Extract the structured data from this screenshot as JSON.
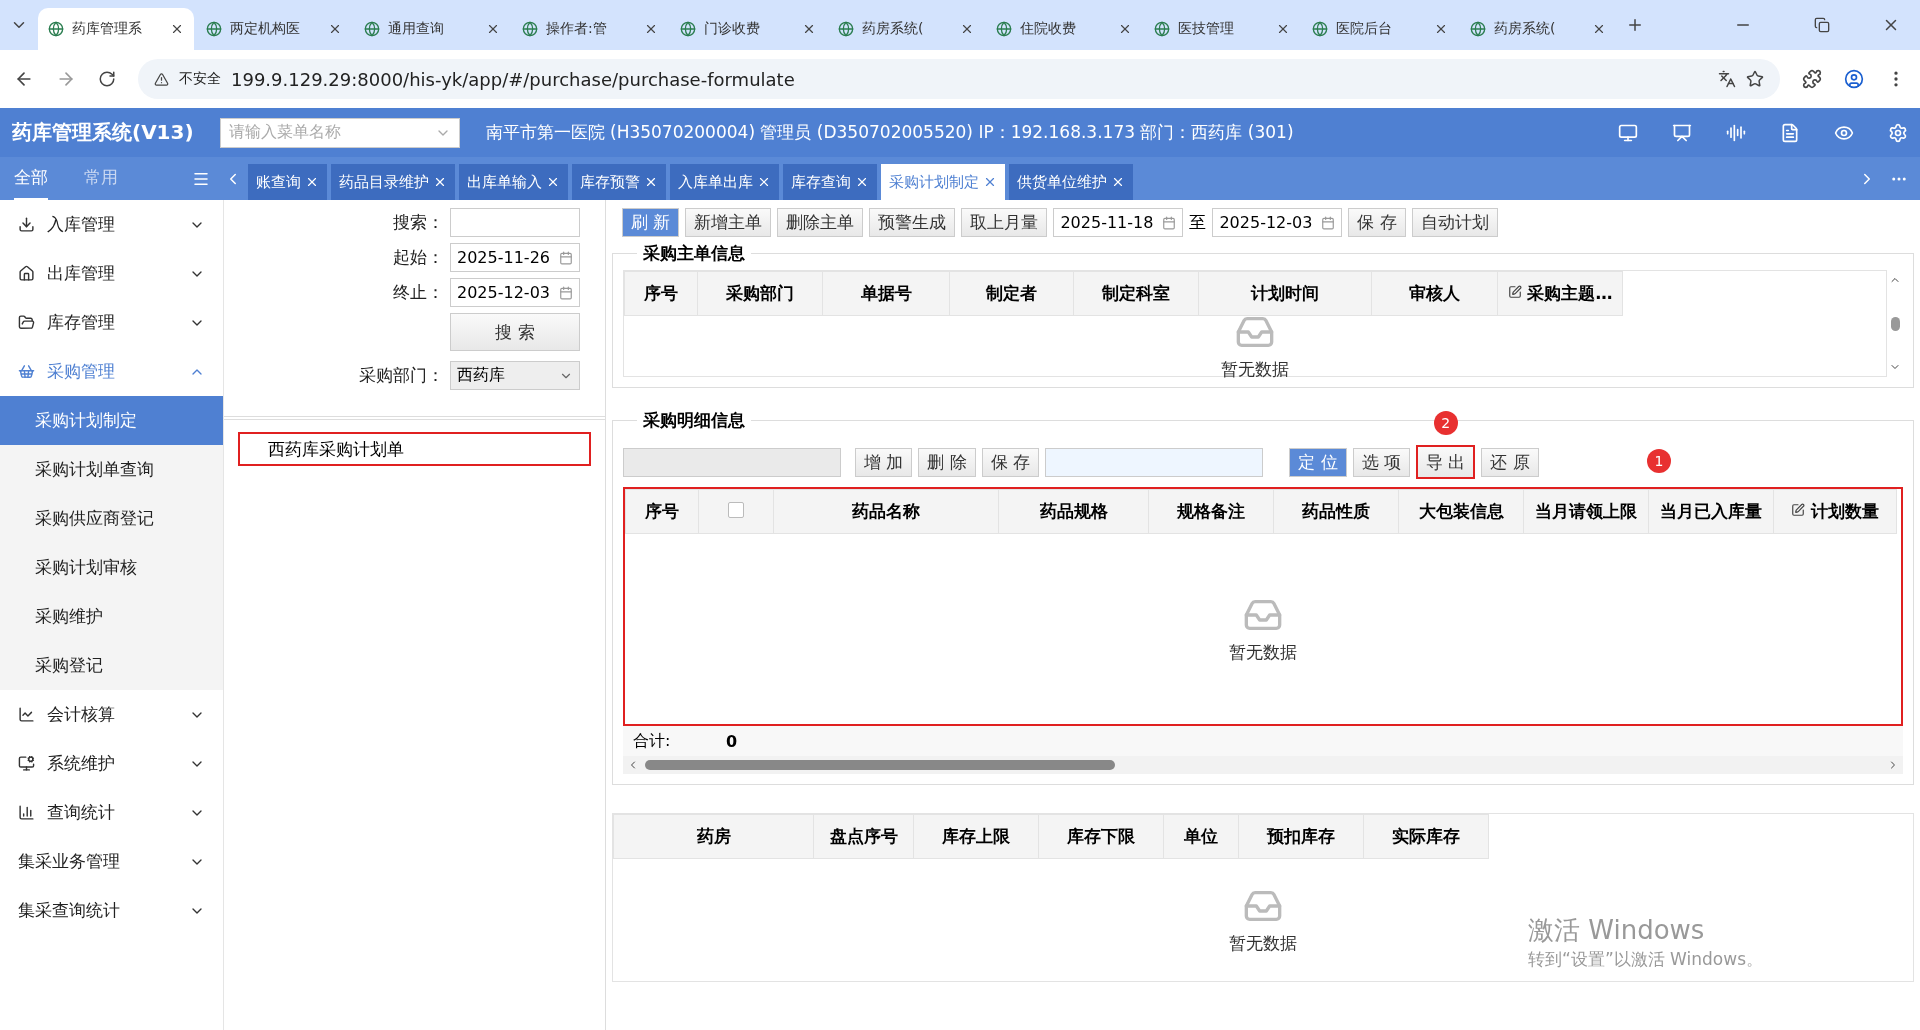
{
  "browser": {
    "tabs": [
      {
        "title": "药库管理系",
        "selected": true
      },
      {
        "title": "两定机构医",
        "selected": false
      },
      {
        "title": "通用查询",
        "selected": false
      },
      {
        "title": "操作者:管",
        "selected": false
      },
      {
        "title": "门诊收费",
        "selected": false
      },
      {
        "title": "药房系统(",
        "selected": false
      },
      {
        "title": "住院收费",
        "selected": false
      },
      {
        "title": "医技管理",
        "selected": false
      },
      {
        "title": "医院后台",
        "selected": false
      },
      {
        "title": "药房系统(",
        "selected": false
      }
    ],
    "address": {
      "warning": "不安全",
      "url": "199.9.129.29:8000/his-yk/app/#/purchase/purchase-formulate"
    }
  },
  "app": {
    "title": "药库管理系统(V13)",
    "menu_search": {
      "placeholder": "请输入菜单名称"
    },
    "info": "南平市第一医院 (H35070200004) 管理员 (D350702005520) IP：192.168.3.173 部门：西药库 (301)"
  },
  "sidebar": {
    "tabs": [
      {
        "label": "全部",
        "selected": true
      },
      {
        "label": "常用",
        "selected": false
      }
    ],
    "items": [
      {
        "label": "入库管理",
        "expanded": false
      },
      {
        "label": "出库管理",
        "expanded": false
      },
      {
        "label": "库存管理",
        "expanded": false
      },
      {
        "label": "采购管理",
        "expanded": true,
        "children": [
          {
            "label": "采购计划制定",
            "selected": true
          },
          {
            "label": "采购计划单查询",
            "selected": false
          },
          {
            "label": "采购供应商登记",
            "selected": false
          },
          {
            "label": "采购计划审核",
            "selected": false
          },
          {
            "label": "采购维护",
            "selected": false
          },
          {
            "label": "采购登记",
            "selected": false
          }
        ]
      },
      {
        "label": "会计核算",
        "expanded": false
      },
      {
        "label": "系统维护",
        "expanded": false
      },
      {
        "label": "查询统计",
        "expanded": false
      },
      {
        "label": "集采业务管理",
        "expanded": false
      },
      {
        "label": "集采查询统计",
        "expanded": false
      }
    ]
  },
  "page_tabs": [
    {
      "label": "账查询",
      "selected": false
    },
    {
      "label": "药品目录维护",
      "selected": false
    },
    {
      "label": "出库单输入",
      "selected": false
    },
    {
      "label": "库存预警",
      "selected": false
    },
    {
      "label": "入库单出库",
      "selected": false
    },
    {
      "label": "库存查询",
      "selected": false
    },
    {
      "label": "采购计划制定",
      "selected": true
    },
    {
      "label": "供货单位维护",
      "selected": false
    }
  ],
  "filter": {
    "fields": [
      {
        "label": "搜索：",
        "kind": "text"
      },
      {
        "label": "起始：",
        "kind": "date",
        "value": "2025-11-26"
      },
      {
        "label": "终止：",
        "kind": "date",
        "value": "2025-12-03"
      }
    ],
    "search_button": "搜 索",
    "department": {
      "label": "采购部门：",
      "value": "西药库"
    },
    "plans": [
      {
        "label": "西药库采购计划单",
        "highlighted": true
      }
    ]
  },
  "toolbar": [
    {
      "kind": "button",
      "label": "刷 新",
      "primary": true
    },
    {
      "kind": "button",
      "label": "新增主单",
      "primary": false
    },
    {
      "kind": "button",
      "label": "删除主单",
      "primary": false
    },
    {
      "kind": "button",
      "label": "预警生成",
      "primary": false
    },
    {
      "kind": "button",
      "label": "取上月量",
      "primary": false
    },
    {
      "kind": "date",
      "label": "2025-11-18"
    },
    {
      "kind": "text",
      "label": "至"
    },
    {
      "kind": "date",
      "label": "2025-12-03"
    },
    {
      "kind": "button",
      "label": "保 存",
      "primary": false
    },
    {
      "kind": "button",
      "label": "自动计划",
      "primary": false
    }
  ],
  "master": {
    "title": "采购主单信息",
    "columns": [
      {
        "label": "序号"
      },
      {
        "label": "采购部门"
      },
      {
        "label": "单据号"
      },
      {
        "label": "制定者"
      },
      {
        "label": "制定科室"
      },
      {
        "label": "计划时间"
      },
      {
        "label": "审核人"
      },
      {
        "label": "采购主题…",
        "editable": true
      }
    ],
    "empty": "暂无数据"
  },
  "detail": {
    "title": "采购明细信息",
    "toolbar": [
      {
        "kind": "field",
        "disabled": true
      },
      {
        "kind": "button",
        "label": "增 加",
        "primary": false,
        "highlighted": false
      },
      {
        "kind": "button",
        "label": "删 除",
        "primary": false,
        "highlighted": false
      },
      {
        "kind": "button",
        "label": "保 存",
        "primary": false,
        "highlighted": false
      },
      {
        "kind": "field",
        "disabled": false
      },
      {
        "kind": "button",
        "label": "定 位",
        "primary": true,
        "highlighted": false
      },
      {
        "kind": "button",
        "label": "选 项",
        "primary": false,
        "highlighted": false
      },
      {
        "kind": "button",
        "label": "导 出",
        "primary": false,
        "highlighted": true,
        "marker": "2"
      },
      {
        "kind": "button",
        "label": "还 原",
        "primary": false,
        "highlighted": false
      }
    ],
    "table_marker": "1",
    "table_highlighted": true,
    "columns": [
      {
        "kind": "text",
        "label": "序号"
      },
      {
        "kind": "checkbox",
        "checked": false
      },
      {
        "kind": "text",
        "label": "药品名称"
      },
      {
        "kind": "text",
        "label": "药品规格"
      },
      {
        "kind": "text",
        "label": "规格备注"
      },
      {
        "kind": "text",
        "label": "药品性质"
      },
      {
        "kind": "text",
        "label": "大包装信息"
      },
      {
        "kind": "text",
        "label": "当月请领上限"
      },
      {
        "kind": "text",
        "label": "当月已入库量"
      },
      {
        "kind": "text",
        "label": "计划数量",
        "editable": true
      }
    ],
    "empty": "暂无数据",
    "footer": {
      "label": "合计:",
      "value": "0"
    }
  },
  "stock": {
    "columns": [
      "药房",
      "盘点序号",
      "库存上限",
      "库存下限",
      "单位",
      "预扣库存",
      "实际库存"
    ],
    "empty": "暂无数据"
  },
  "os_watermark": {
    "title": "激活 Windows",
    "subtitle": "转到“设置”以激活 Windows。"
  }
}
